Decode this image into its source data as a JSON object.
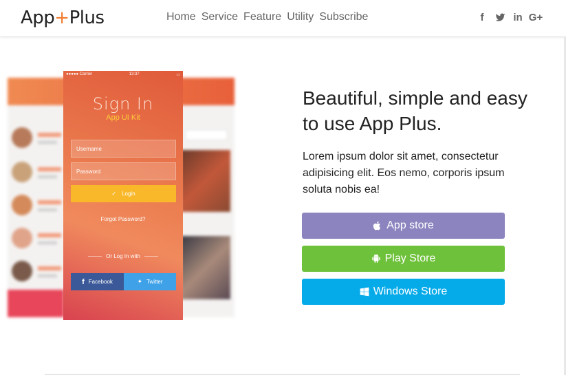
{
  "brand": {
    "name_left": "App",
    "name_plus": "+",
    "name_right": "Plus",
    "accent": "#f27a2a"
  },
  "nav": {
    "items": [
      {
        "label": "Home"
      },
      {
        "label": "Service"
      },
      {
        "label": "Feature"
      },
      {
        "label": "Utility"
      },
      {
        "label": "Subscribe"
      }
    ]
  },
  "social": [
    {
      "icon": "facebook-icon",
      "glyph": "f"
    },
    {
      "icon": "twitter-icon"
    },
    {
      "icon": "linkedin-icon",
      "glyph": "in"
    },
    {
      "icon": "google-plus-icon",
      "glyph": "G+"
    }
  ],
  "phone": {
    "status_carrier": "●●●●● Carrier",
    "status_time": "13:37",
    "title": "Sign In",
    "subtitle": "App UI Kit",
    "username_placeholder": "Username",
    "password_placeholder": "Password",
    "login_label": "Login",
    "forgot_label": "Forgot Password?",
    "or_login_label": "Or Log In with",
    "facebook_label": "Facebook",
    "twitter_label": "Twitter"
  },
  "hero": {
    "headline": "Beautiful, simple and easy to use App Plus.",
    "lead": "Lorem ipsum dolor sit amet, consectetur adipisicing elit. Eos nemo, corporis ipsum soluta nobis ea!"
  },
  "stores": {
    "app_store": {
      "label": "Apple App store",
      "text": "App store",
      "color": "#8b84bf"
    },
    "play_store": {
      "label": "Play Store",
      "color": "#6ec13a"
    },
    "windows_store": {
      "label": "Windows Store",
      "color": "#05aae9"
    }
  }
}
